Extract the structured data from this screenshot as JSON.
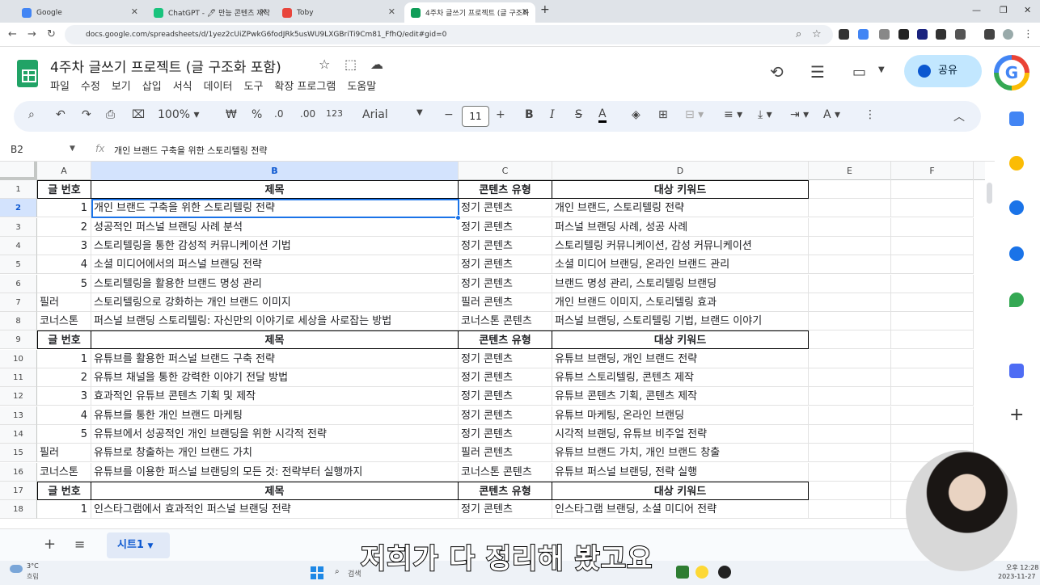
{
  "browser": {
    "tabs": [
      {
        "label": "Google",
        "color": "#4285f4",
        "close": "✕"
      },
      {
        "label": "ChatGPT - 🖊 만능 콘텐츠 제작",
        "color": "#19c37d",
        "close": "✕"
      },
      {
        "label": "Toby",
        "color": "#e8453c",
        "close": "✕"
      },
      {
        "label": "4주차 글쓰기 프로젝트 (글 구조화",
        "color": "#0f9d58",
        "close": "✕"
      }
    ],
    "new_tab": "+",
    "url": "docs.google.com/spreadsheets/d/1yez2cUiZPwkG6fodJRk5usWU9LXGBriTi9Cm81_FfhQ/edit#gid=0"
  },
  "doc": {
    "title": "4주차 글쓰기 프로젝트 (글 구조화 포함)",
    "menu": [
      "파일",
      "수정",
      "보기",
      "삽입",
      "서식",
      "데이터",
      "도구",
      "확장 프로그램",
      "도움말"
    ],
    "share_label": "공유"
  },
  "toolbar": {
    "zoom": "100%",
    "currency": "₩",
    "percent": "%",
    "dec_dec": ".0",
    "inc_dec": ".00",
    "number_format": "123",
    "font": "Arial",
    "font_size": "11"
  },
  "formula": {
    "cell": "B2",
    "value": "개인 브랜드 구축을 위한 스토리텔링 전략"
  },
  "columns": [
    "A",
    "B",
    "C",
    "D",
    "E",
    "F"
  ],
  "rows": [
    {
      "n": "1",
      "a": "글 번호",
      "b": "제목",
      "c": "콘텐츠 유형",
      "d": "대상 키워드",
      "header": true
    },
    {
      "n": "2",
      "a": "1",
      "b": "개인 브랜드 구축을 위한 스토리텔링 전략",
      "c": "정기 콘텐츠",
      "d": "개인 브랜드, 스토리텔링 전략"
    },
    {
      "n": "3",
      "a": "2",
      "b": "성공적인 퍼스널 브랜딩 사례 분석",
      "c": "정기 콘텐츠",
      "d": "퍼스널 브랜딩 사례, 성공 사례"
    },
    {
      "n": "4",
      "a": "3",
      "b": "스토리텔링을 통한 감성적 커뮤니케이션 기법",
      "c": "정기 콘텐츠",
      "d": "스토리텔링 커뮤니케이션, 감성 커뮤니케이션"
    },
    {
      "n": "5",
      "a": "4",
      "b": "소셜 미디어에서의 퍼스널 브랜딩 전략",
      "c": "정기 콘텐츠",
      "d": "소셜 미디어 브랜딩, 온라인 브랜드 관리"
    },
    {
      "n": "6",
      "a": "5",
      "b": "스토리텔링을 활용한 브랜드 명성 관리",
      "c": "정기 콘텐츠",
      "d": "브랜드 명성 관리, 스토리텔링 브랜딩"
    },
    {
      "n": "7",
      "a": "필러",
      "b": "스토리텔링으로 강화하는 개인 브랜드 이미지",
      "c": "필러 콘텐츠",
      "d": "개인 브랜드 이미지, 스토리텔링 효과"
    },
    {
      "n": "8",
      "a": "코너스톤",
      "b": "퍼스널 브랜딩 스토리텔링: 자신만의 이야기로 세상을 사로잡는 방법",
      "c": "코너스톤 콘텐츠",
      "d": "퍼스널 브랜딩, 스토리텔링 기법, 브랜드 이야기"
    },
    {
      "n": "9",
      "a": "글 번호",
      "b": "제목",
      "c": "콘텐츠 유형",
      "d": "대상 키워드",
      "header": true
    },
    {
      "n": "10",
      "a": "1",
      "b": "유튜브를 활용한 퍼스널 브랜드 구축 전략",
      "c": "정기 콘텐츠",
      "d": "유튜브 브랜딩, 개인 브랜드 전략"
    },
    {
      "n": "11",
      "a": "2",
      "b": "유튜브 채널을 통한 강력한 이야기 전달 방법",
      "c": "정기 콘텐츠",
      "d": "유튜브 스토리텔링, 콘텐츠 제작"
    },
    {
      "n": "12",
      "a": "3",
      "b": "효과적인 유튜브 콘텐츠 기획 및 제작",
      "c": "정기 콘텐츠",
      "d": "유튜브 콘텐츠 기획, 콘텐츠 제작"
    },
    {
      "n": "13",
      "a": "4",
      "b": "유튜브를 통한 개인 브랜드 마케팅",
      "c": "정기 콘텐츠",
      "d": "유튜브 마케팅, 온라인 브랜딩"
    },
    {
      "n": "14",
      "a": "5",
      "b": "유튜브에서 성공적인 개인 브랜딩을 위한 시각적 전략",
      "c": "정기 콘텐츠",
      "d": "시각적 브랜딩, 유튜브 비주얼 전략"
    },
    {
      "n": "15",
      "a": "필러",
      "b": "유튜브로 창출하는 개인 브랜드 가치",
      "c": "필러 콘텐츠",
      "d": "유튜브 브랜드 가치, 개인 브랜드 창출"
    },
    {
      "n": "16",
      "a": "코너스톤",
      "b": "유튜브를 이용한 퍼스널 브랜딩의 모든 것: 전략부터 실행까지",
      "c": "코너스톤 콘텐츠",
      "d": "유튜브 퍼스널 브랜딩, 전략 실행"
    },
    {
      "n": "17",
      "a": "글 번호",
      "b": "제목",
      "c": "콘텐츠 유형",
      "d": "대상 키워드",
      "header": true
    },
    {
      "n": "18",
      "a": "1",
      "b": "인스타그램에서 효과적인 퍼스널 브랜딩 전략",
      "c": "정기 콘텐츠",
      "d": "인스타그램 브랜딩, 소셜 미디어 전략"
    }
  ],
  "sheet_tab": "시트1",
  "subtitle": "저희가 다 정리해 봤고요",
  "taskbar": {
    "weather_temp": "3°C",
    "weather_desc": "흐림",
    "search": "검색",
    "time": "오후 12:28",
    "date": "2023-11-27"
  }
}
